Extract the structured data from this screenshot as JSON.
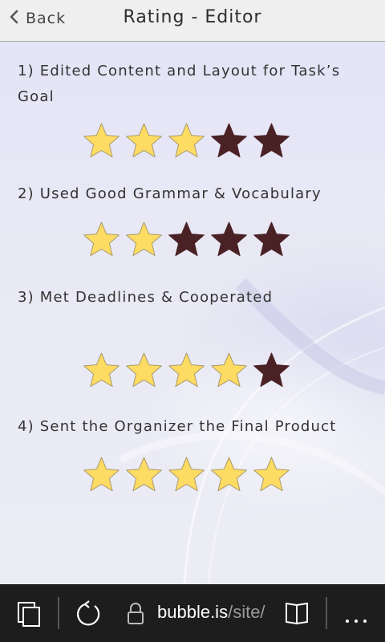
{
  "header": {
    "back_label": "Back",
    "title": "Rating - Editor"
  },
  "questions": [
    {
      "label": "1) Edited Content and Layout for Task’s Goal",
      "rating": 3,
      "max": 5
    },
    {
      "label": "2) Used Good Grammar & Vocabulary",
      "rating": 2,
      "max": 5
    },
    {
      "label": "3) Met Deadlines & Cooperated",
      "rating": 4,
      "max": 5
    },
    {
      "label": "4) Sent the Organizer the Final Product",
      "rating": 5,
      "max": 5
    }
  ],
  "colors": {
    "star_filled": "#fedc63",
    "star_empty": "#4a2226",
    "star_outline": "#a89a6a"
  },
  "browser": {
    "url_host": "bubble.is",
    "url_path": "/site/",
    "icons": [
      "tabs-icon",
      "refresh-icon",
      "lock-icon",
      "reading-view-icon",
      "more-icon"
    ]
  }
}
